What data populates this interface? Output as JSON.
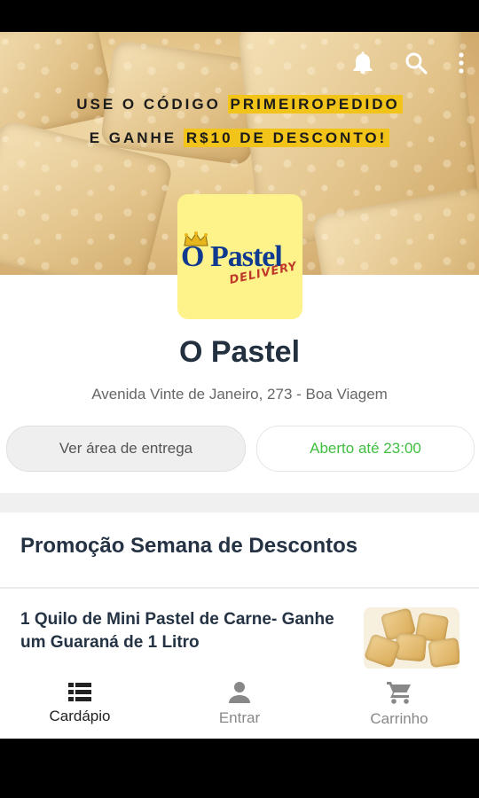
{
  "banner": {
    "promo_line1_prefix": "USE O CÓDIGO",
    "promo_code": "PRIMEIROPEDIDO",
    "promo_line2_prefix": "E GANHE",
    "promo_amount": "R$10 DE DESCONTO!",
    "icons": [
      "bell-icon",
      "search-icon",
      "more-vert-icon"
    ]
  },
  "logo": {
    "text": "O Pastel",
    "subtext": "DELIVERY"
  },
  "store": {
    "name": "O Pastel",
    "address": "Avenida Vinte de Janeiro, 273 - Boa Viagem"
  },
  "actions": {
    "delivery_area": "Ver área de entrega",
    "open_status": "Aberto até 23:00"
  },
  "menu": {
    "section_title": "Promoção Semana de Descontos",
    "items": [
      {
        "title": "1 Quilo de Mini Pastel de Carne- Ganhe um Guaraná de 1 Litro"
      }
    ]
  },
  "nav": {
    "items": [
      {
        "label": "Cardápio",
        "icon": "list-icon",
        "active": true
      },
      {
        "label": "Entrar",
        "icon": "person-icon",
        "active": false
      },
      {
        "label": "Carrinho",
        "icon": "cart-icon",
        "active": false
      }
    ]
  },
  "colors": {
    "accent_yellow": "#f2c318",
    "open_green": "#3fbf3f",
    "title_dark": "#243244",
    "logo_bg": "#fdf38a",
    "logo_blue": "#0f3a8f"
  }
}
